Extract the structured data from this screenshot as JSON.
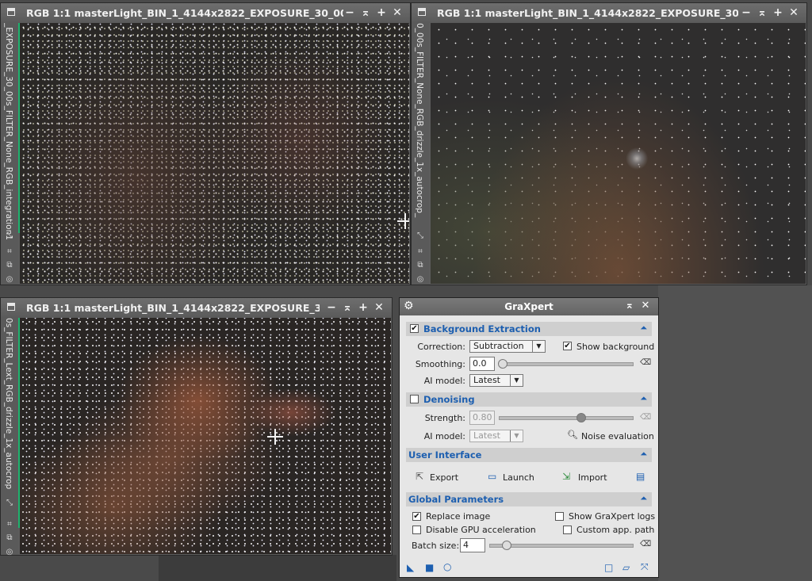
{
  "window1": {
    "title": "RGB 1:1 masterLight_BIN_1_4144x2822_EXPOSURE_30_00...",
    "side_label": "_EXPOSURE_30_00s_FILTER_None_RGB_integration1"
  },
  "window2": {
    "title": "RGB 1:1 masterLight_BIN_1_4144x2822_EXPOSURE_30...",
    "side_label": "0_00s_FILTER_None_RGB_drizzle_1x_autocrop_"
  },
  "window3": {
    "title": "RGB 1:1 masterLight_BIN_1_4144x2822_EXPOSURE_3...",
    "side_label": "0s_FILTER_Lext_RGB_drizzle_1x_autocrop"
  },
  "window_buttons": {
    "minimize": "−",
    "shade": "⌅",
    "maximize": "+",
    "close": "✕"
  },
  "graxpert": {
    "title": "GraXpert",
    "background_extraction": {
      "label": "Background Extraction",
      "checked": true,
      "correction_label": "Correction:",
      "correction_value": "Subtraction",
      "show_background_label": "Show background",
      "show_background_checked": true,
      "smoothing_label": "Smoothing:",
      "smoothing_value": "0.0",
      "ai_model_label": "AI model:",
      "ai_model_value": "Latest"
    },
    "denoising": {
      "label": "Denoising",
      "checked": false,
      "strength_label": "Strength:",
      "strength_value": "0.80",
      "ai_model_label": "AI model:",
      "ai_model_value": "Latest",
      "noise_evaluation_label": "Noise evaluation"
    },
    "user_interface": {
      "label": "User Interface",
      "export_label": "Export",
      "launch_label": "Launch",
      "import_label": "Import"
    },
    "global_parameters": {
      "label": "Global Parameters",
      "replace_image_label": "Replace image",
      "replace_image_checked": true,
      "show_logs_label": "Show GraXpert logs",
      "show_logs_checked": false,
      "disable_gpu_label": "Disable GPU acceleration",
      "disable_gpu_checked": false,
      "custom_path_label": "Custom app. path",
      "custom_path_checked": false,
      "batch_size_label": "Batch size:",
      "batch_size_value": "4"
    }
  }
}
